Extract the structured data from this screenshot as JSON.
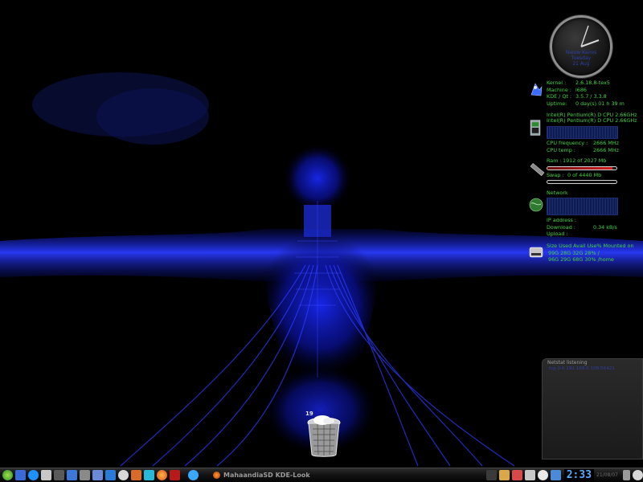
{
  "clock": {
    "line1": "Nieuw Kairos",
    "line2": "Tuesday",
    "line3": "21 Aug"
  },
  "sysinfo": {
    "kernel_label": "Kernel :",
    "kernel_value": "2.6.18.8-tex5",
    "machine_label": "Machine :",
    "machine_value": "i686",
    "kde_label": "KDE / Qt :",
    "kde_value": "3.5.7  /   3.3.8",
    "uptime_label": "Uptime:",
    "uptime_value": "0 day(s)  01 h 39 m"
  },
  "cpu": {
    "model1": "Intel(R) Pentium(R) D  CPU 2.66GHz",
    "model2": "Intel(R) Pentium(R) D  CPU 2.66GHz",
    "freq_label": "CPU frequency :",
    "freq_value": "2666 MHz",
    "temp_label": "CPU temp :",
    "temp_value": "2666 MHz"
  },
  "memory": {
    "ram_label": "Ram :",
    "ram_value": "1912 of 2027 Mb",
    "ram_fraction": 0.94,
    "swap_label": "Swap :",
    "swap_value": "0 of 4440 Mb",
    "swap_fraction": 0.0
  },
  "network": {
    "title": "Network",
    "ip_label": "IP address :",
    "ip_value": "",
    "download_label": "Download :",
    "download_value": "0.34 kB/s",
    "upload_label": "Upload :",
    "upload_value": ""
  },
  "disks": {
    "header": "Size  Used Avail Use% Mounted on",
    "rows": [
      "99G   28G   32G  28% /",
      "96G   29G   68G  30% /home"
    ]
  },
  "netstat": {
    "title": "Netstat listening",
    "line": "tcp    0     0  192.168.0.108:56421"
  },
  "trash": {
    "count": "19"
  },
  "taskbar": {
    "task_title": "MahaandiaSD KDE-Look",
    "time": "2:33",
    "date": "21/08/07"
  },
  "colors": {
    "text_green": "#3fd23f",
    "accent_blue": "#2233cc",
    "clock_blue": "#5aa8ff"
  }
}
